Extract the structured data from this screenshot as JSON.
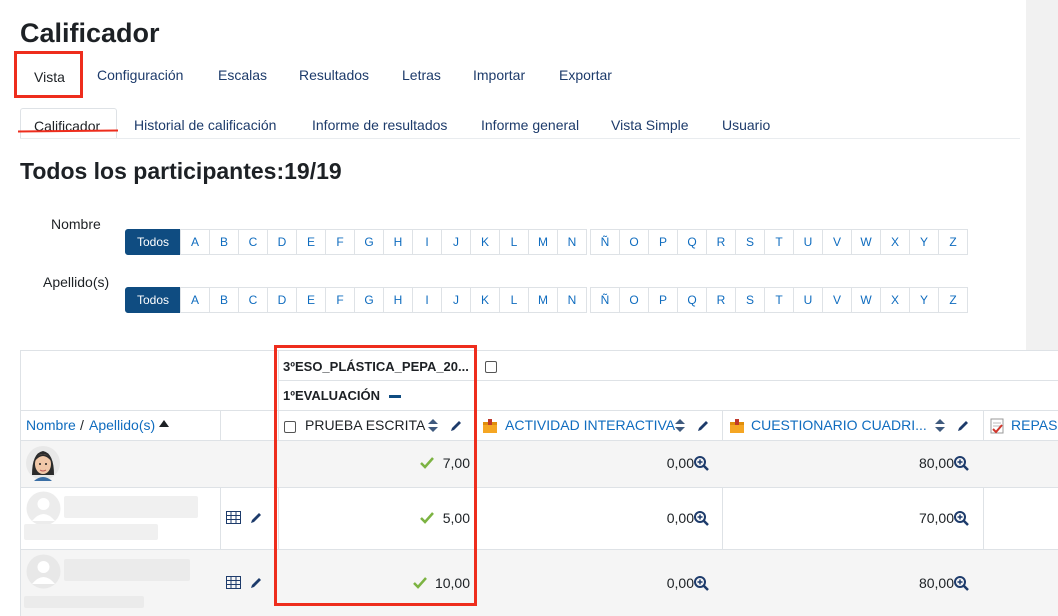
{
  "page_title": "Calificador",
  "nav_tabs": [
    "Vista",
    "Configuración",
    "Escalas",
    "Resultados",
    "Letras",
    "Importar",
    "Exportar"
  ],
  "sub_tabs": [
    "Calificador",
    "Historial de calificación",
    "Informe de resultados",
    "Informe general",
    "Vista Simple",
    "Usuario"
  ],
  "participants_heading": "Todos los participantes:19/19",
  "filters": {
    "first_name_label": "Nombre",
    "last_name_label": "Apellido(s)",
    "all_label": "Todos",
    "letters": [
      "A",
      "B",
      "C",
      "D",
      "E",
      "F",
      "G",
      "H",
      "I",
      "J",
      "K",
      "L",
      "M",
      "N",
      "Ñ",
      "O",
      "P",
      "Q",
      "R",
      "S",
      "T",
      "U",
      "V",
      "W",
      "X",
      "Y",
      "Z"
    ]
  },
  "grader": {
    "course_category": "3ºESO_PLÁSTICA_PEPA_20...",
    "evaluation_category": "1ºEVALUACIÓN",
    "name_header_first": "Nombre",
    "name_header_sep": "/",
    "name_header_last": "Apellido(s)",
    "columns": [
      "PRUEBA ESCRITA",
      "ACTIVIDAD INTERACTIVA",
      "CUESTIONARIO CUADRI...",
      "REPAS"
    ],
    "rows": [
      {
        "grades": [
          "7,00",
          "0,00",
          "80,00"
        ]
      },
      {
        "grades": [
          "5,00",
          "0,00",
          "70,00"
        ]
      },
      {
        "grades": [
          "10,00",
          "0,00",
          "80,00"
        ]
      }
    ]
  },
  "colors": {
    "highlight": "#ee2d1d",
    "link": "#0f6cbf",
    "active_button": "#0f4c81",
    "check": "#7cb342"
  }
}
